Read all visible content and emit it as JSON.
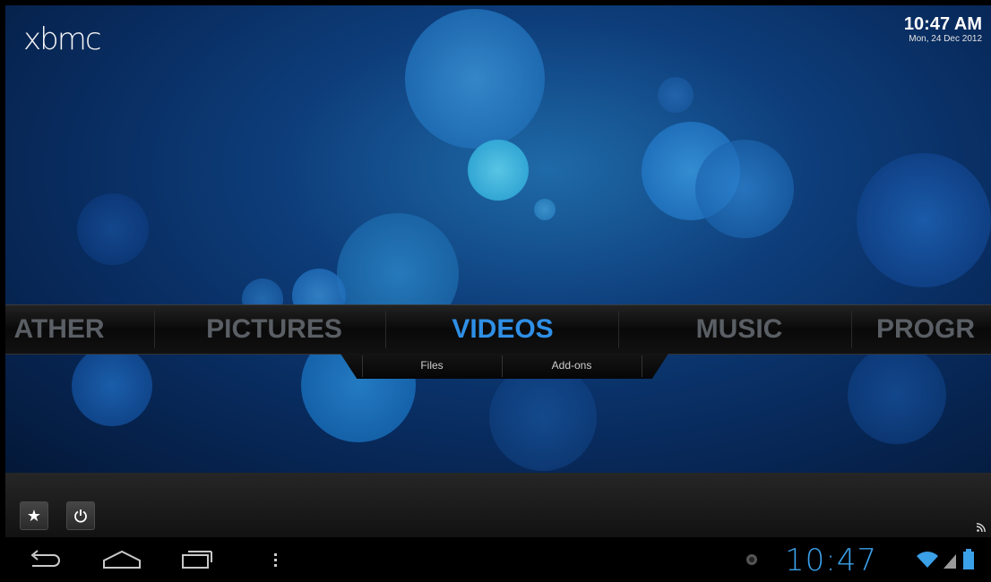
{
  "app": {
    "logo": "xbmc"
  },
  "clock": {
    "time": "10:47 AM",
    "date": "Mon, 24 Dec 2012"
  },
  "main_menu": {
    "items": [
      {
        "label": "ATHER"
      },
      {
        "label": "PICTURES"
      },
      {
        "label": "VIDEOS"
      },
      {
        "label": "MUSIC"
      },
      {
        "label": "PROGR"
      }
    ],
    "active": "VIDEOS",
    "submenu": [
      {
        "label": "Files"
      },
      {
        "label": "Add-ons"
      }
    ]
  },
  "bottom_bar": {
    "buttons": [
      {
        "icon": "star-icon"
      },
      {
        "icon": "power-icon"
      }
    ],
    "indicator_icon": "rss-icon"
  },
  "android_nav": {
    "buttons": [
      {
        "icon": "back-icon"
      },
      {
        "icon": "home-icon"
      },
      {
        "icon": "recent-apps-icon"
      },
      {
        "icon": "menu-icon"
      }
    ],
    "status_time": "10:47",
    "status_icons": [
      "notification-dot-icon",
      "wifi-icon",
      "signal-icon",
      "battery-icon"
    ]
  },
  "colors": {
    "accent": "#2f8fe6",
    "inactive_menu": "#5a5f65",
    "status_time": "#3aa0e8"
  }
}
